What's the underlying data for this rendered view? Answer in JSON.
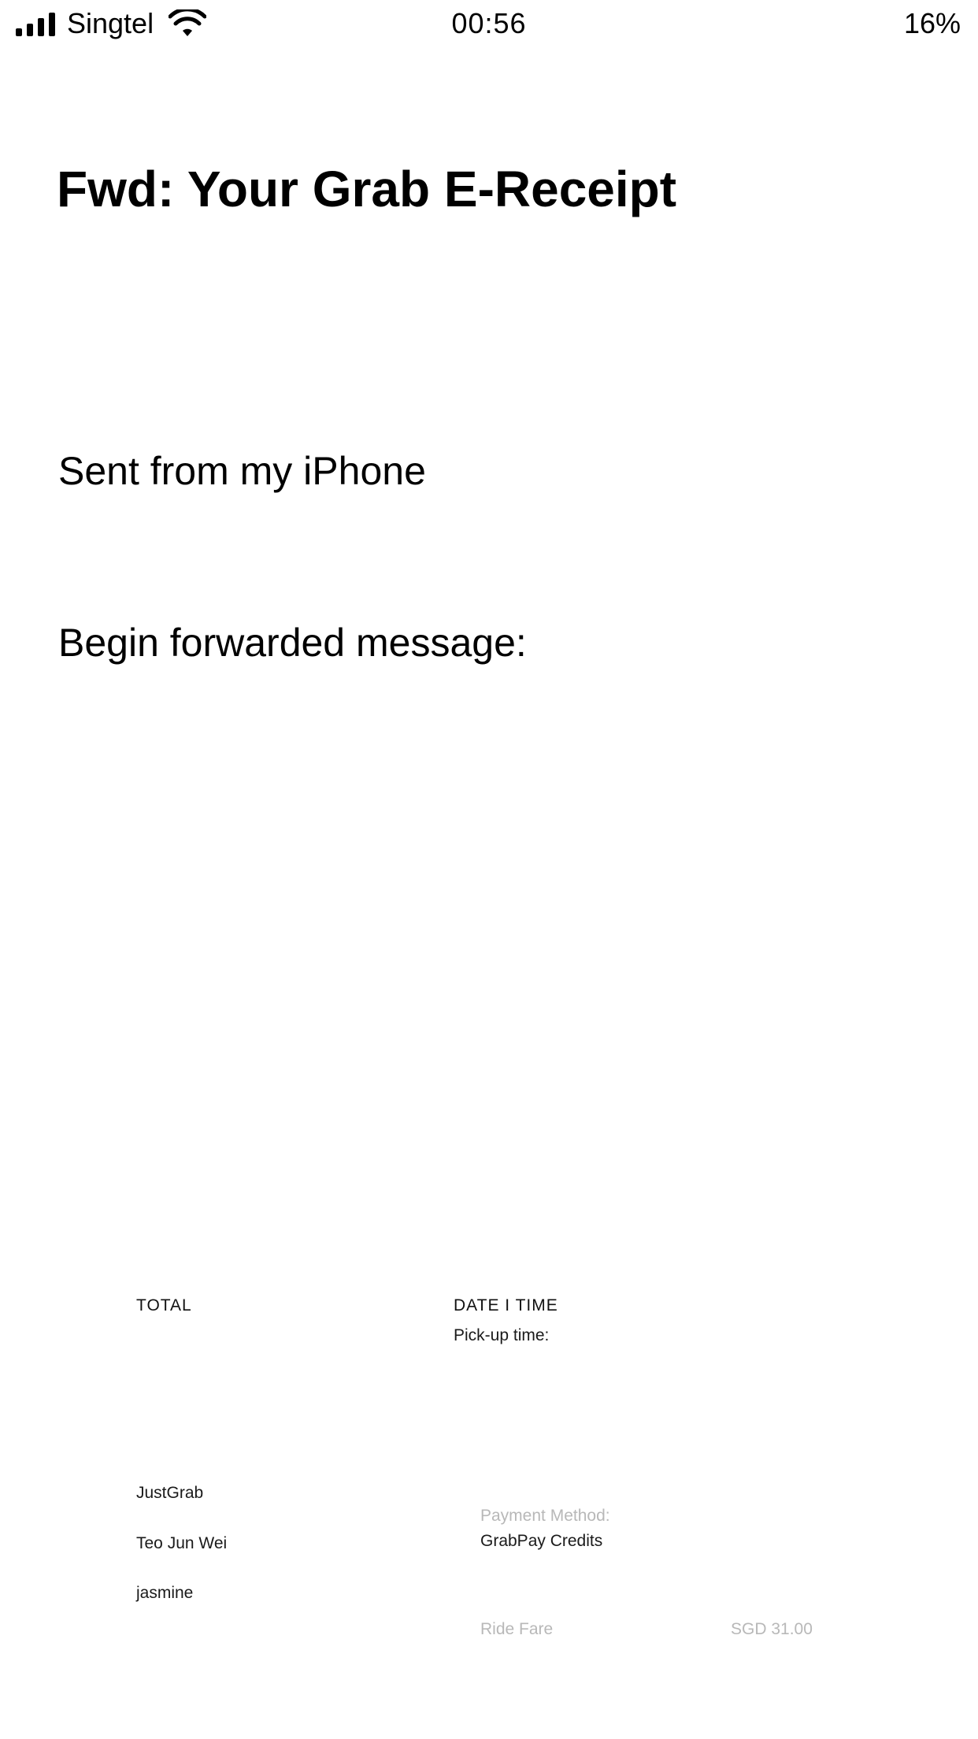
{
  "status_bar": {
    "carrier": "Singtel",
    "time": "00:56",
    "battery": "16%",
    "icons": [
      "signal-bars-icon",
      "wifi-icon"
    ]
  },
  "email": {
    "subject": "Fwd:  Your Grab E-Receipt",
    "sent_from": "Sent from my iPhone",
    "forwarded_intro": "Begin forwarded message:"
  },
  "receipt": {
    "total_label": "TOTAL",
    "datetime_label": "DATE  I  TIME",
    "pickup_label": "Pick-up time:",
    "service": "JustGrab",
    "driver": "Teo Jun Wei",
    "passenger": "jasmine",
    "payment_method_label": "Payment Method:",
    "payment_method": "GrabPay Credits",
    "ride_fare_label": "Ride Fare",
    "ride_fare_value": "SGD 31.00"
  }
}
